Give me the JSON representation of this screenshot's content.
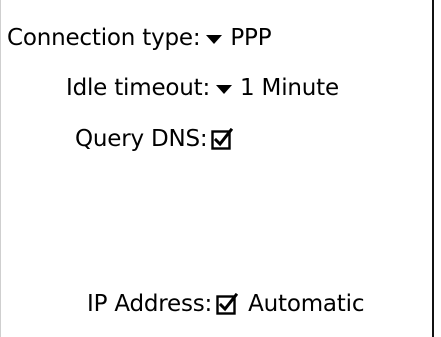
{
  "settings": {
    "connection_type": {
      "label": "Connection type:",
      "value": "PPP"
    },
    "idle_timeout": {
      "label": "Idle timeout:",
      "value": "1 Minute"
    },
    "query_dns": {
      "label": "Query DNS:",
      "checked": true
    },
    "ip_address": {
      "label": "IP Address:",
      "checked": true,
      "checkbox_label": "Automatic"
    }
  },
  "icons": {
    "dropdown": "triangle-down-icon",
    "checkbox": "checked-box-icon"
  },
  "colors": {
    "background": "#ffffff",
    "text": "#000000",
    "right_border": "#111111"
  }
}
